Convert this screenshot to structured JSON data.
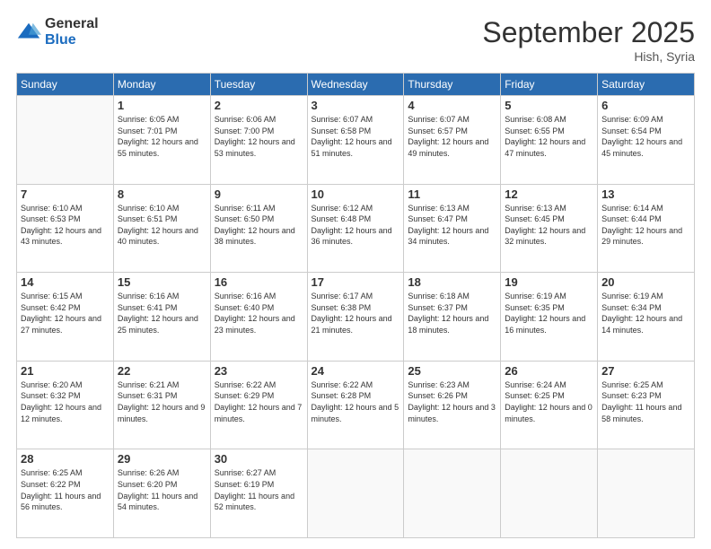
{
  "logo": {
    "general": "General",
    "blue": "Blue"
  },
  "header": {
    "month": "September 2025",
    "location": "Hish, Syria"
  },
  "weekdays": [
    "Sunday",
    "Monday",
    "Tuesday",
    "Wednesday",
    "Thursday",
    "Friday",
    "Saturday"
  ],
  "weeks": [
    [
      {
        "day": "",
        "sunrise": "",
        "sunset": "",
        "daylight": ""
      },
      {
        "day": "1",
        "sunrise": "Sunrise: 6:05 AM",
        "sunset": "Sunset: 7:01 PM",
        "daylight": "Daylight: 12 hours and 55 minutes."
      },
      {
        "day": "2",
        "sunrise": "Sunrise: 6:06 AM",
        "sunset": "Sunset: 7:00 PM",
        "daylight": "Daylight: 12 hours and 53 minutes."
      },
      {
        "day": "3",
        "sunrise": "Sunrise: 6:07 AM",
        "sunset": "Sunset: 6:58 PM",
        "daylight": "Daylight: 12 hours and 51 minutes."
      },
      {
        "day": "4",
        "sunrise": "Sunrise: 6:07 AM",
        "sunset": "Sunset: 6:57 PM",
        "daylight": "Daylight: 12 hours and 49 minutes."
      },
      {
        "day": "5",
        "sunrise": "Sunrise: 6:08 AM",
        "sunset": "Sunset: 6:55 PM",
        "daylight": "Daylight: 12 hours and 47 minutes."
      },
      {
        "day": "6",
        "sunrise": "Sunrise: 6:09 AM",
        "sunset": "Sunset: 6:54 PM",
        "daylight": "Daylight: 12 hours and 45 minutes."
      }
    ],
    [
      {
        "day": "7",
        "sunrise": "Sunrise: 6:10 AM",
        "sunset": "Sunset: 6:53 PM",
        "daylight": "Daylight: 12 hours and 43 minutes."
      },
      {
        "day": "8",
        "sunrise": "Sunrise: 6:10 AM",
        "sunset": "Sunset: 6:51 PM",
        "daylight": "Daylight: 12 hours and 40 minutes."
      },
      {
        "day": "9",
        "sunrise": "Sunrise: 6:11 AM",
        "sunset": "Sunset: 6:50 PM",
        "daylight": "Daylight: 12 hours and 38 minutes."
      },
      {
        "day": "10",
        "sunrise": "Sunrise: 6:12 AM",
        "sunset": "Sunset: 6:48 PM",
        "daylight": "Daylight: 12 hours and 36 minutes."
      },
      {
        "day": "11",
        "sunrise": "Sunrise: 6:13 AM",
        "sunset": "Sunset: 6:47 PM",
        "daylight": "Daylight: 12 hours and 34 minutes."
      },
      {
        "day": "12",
        "sunrise": "Sunrise: 6:13 AM",
        "sunset": "Sunset: 6:45 PM",
        "daylight": "Daylight: 12 hours and 32 minutes."
      },
      {
        "day": "13",
        "sunrise": "Sunrise: 6:14 AM",
        "sunset": "Sunset: 6:44 PM",
        "daylight": "Daylight: 12 hours and 29 minutes."
      }
    ],
    [
      {
        "day": "14",
        "sunrise": "Sunrise: 6:15 AM",
        "sunset": "Sunset: 6:42 PM",
        "daylight": "Daylight: 12 hours and 27 minutes."
      },
      {
        "day": "15",
        "sunrise": "Sunrise: 6:16 AM",
        "sunset": "Sunset: 6:41 PM",
        "daylight": "Daylight: 12 hours and 25 minutes."
      },
      {
        "day": "16",
        "sunrise": "Sunrise: 6:16 AM",
        "sunset": "Sunset: 6:40 PM",
        "daylight": "Daylight: 12 hours and 23 minutes."
      },
      {
        "day": "17",
        "sunrise": "Sunrise: 6:17 AM",
        "sunset": "Sunset: 6:38 PM",
        "daylight": "Daylight: 12 hours and 21 minutes."
      },
      {
        "day": "18",
        "sunrise": "Sunrise: 6:18 AM",
        "sunset": "Sunset: 6:37 PM",
        "daylight": "Daylight: 12 hours and 18 minutes."
      },
      {
        "day": "19",
        "sunrise": "Sunrise: 6:19 AM",
        "sunset": "Sunset: 6:35 PM",
        "daylight": "Daylight: 12 hours and 16 minutes."
      },
      {
        "day": "20",
        "sunrise": "Sunrise: 6:19 AM",
        "sunset": "Sunset: 6:34 PM",
        "daylight": "Daylight: 12 hours and 14 minutes."
      }
    ],
    [
      {
        "day": "21",
        "sunrise": "Sunrise: 6:20 AM",
        "sunset": "Sunset: 6:32 PM",
        "daylight": "Daylight: 12 hours and 12 minutes."
      },
      {
        "day": "22",
        "sunrise": "Sunrise: 6:21 AM",
        "sunset": "Sunset: 6:31 PM",
        "daylight": "Daylight: 12 hours and 9 minutes."
      },
      {
        "day": "23",
        "sunrise": "Sunrise: 6:22 AM",
        "sunset": "Sunset: 6:29 PM",
        "daylight": "Daylight: 12 hours and 7 minutes."
      },
      {
        "day": "24",
        "sunrise": "Sunrise: 6:22 AM",
        "sunset": "Sunset: 6:28 PM",
        "daylight": "Daylight: 12 hours and 5 minutes."
      },
      {
        "day": "25",
        "sunrise": "Sunrise: 6:23 AM",
        "sunset": "Sunset: 6:26 PM",
        "daylight": "Daylight: 12 hours and 3 minutes."
      },
      {
        "day": "26",
        "sunrise": "Sunrise: 6:24 AM",
        "sunset": "Sunset: 6:25 PM",
        "daylight": "Daylight: 12 hours and 0 minutes."
      },
      {
        "day": "27",
        "sunrise": "Sunrise: 6:25 AM",
        "sunset": "Sunset: 6:23 PM",
        "daylight": "Daylight: 11 hours and 58 minutes."
      }
    ],
    [
      {
        "day": "28",
        "sunrise": "Sunrise: 6:25 AM",
        "sunset": "Sunset: 6:22 PM",
        "daylight": "Daylight: 11 hours and 56 minutes."
      },
      {
        "day": "29",
        "sunrise": "Sunrise: 6:26 AM",
        "sunset": "Sunset: 6:20 PM",
        "daylight": "Daylight: 11 hours and 54 minutes."
      },
      {
        "day": "30",
        "sunrise": "Sunrise: 6:27 AM",
        "sunset": "Sunset: 6:19 PM",
        "daylight": "Daylight: 11 hours and 52 minutes."
      },
      {
        "day": "",
        "sunrise": "",
        "sunset": "",
        "daylight": ""
      },
      {
        "day": "",
        "sunrise": "",
        "sunset": "",
        "daylight": ""
      },
      {
        "day": "",
        "sunrise": "",
        "sunset": "",
        "daylight": ""
      },
      {
        "day": "",
        "sunrise": "",
        "sunset": "",
        "daylight": ""
      }
    ]
  ]
}
